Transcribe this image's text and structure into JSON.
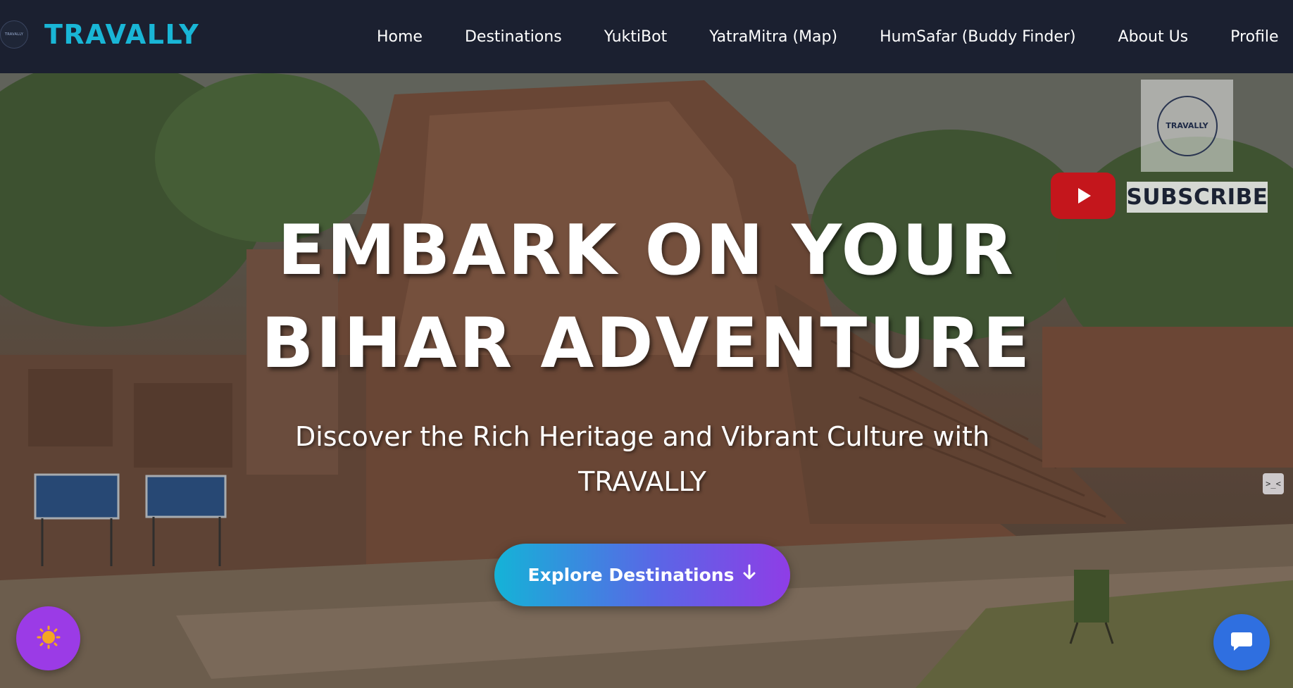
{
  "navbar": {
    "logo_text": "TRAVALLY",
    "brand_name": "TRAVALLY",
    "links": [
      {
        "label": "Home"
      },
      {
        "label": "Destinations"
      },
      {
        "label": "YuktiBot"
      },
      {
        "label": "YatraMitra (Map)"
      },
      {
        "label": "HumSafar (Buddy Finder)"
      },
      {
        "label": "About Us"
      },
      {
        "label": "Profile"
      }
    ]
  },
  "hero": {
    "title_line1": "EMBARK ON YOUR",
    "title_line2": "BIHAR ADVENTURE",
    "subtitle": "Discover the Rich Heritage and Vibrant Culture with TRAVALLY",
    "cta_label": "Explore Destinations",
    "cta_icon": "arrow-down-icon"
  },
  "video_overlay": {
    "channel_logo_text": "TRAVALLY",
    "subscribe_label": "SUBSCRIBE",
    "play_icon": "youtube-play-icon"
  },
  "floating": {
    "theme_toggle_icon": "sun-icon",
    "chat_icon": "chat-bubble-icon",
    "side_icon_glyph": ">_<"
  },
  "colors": {
    "brand": "#19b6d6",
    "navbar_bg": "#1b2030",
    "cta_start": "#14b3d7",
    "cta_end": "#8f3de6",
    "theme_button": "#9b3be6",
    "chat_button": "#2f6fe0",
    "youtube_red": "#c4161c",
    "sun": "#f5a623"
  }
}
